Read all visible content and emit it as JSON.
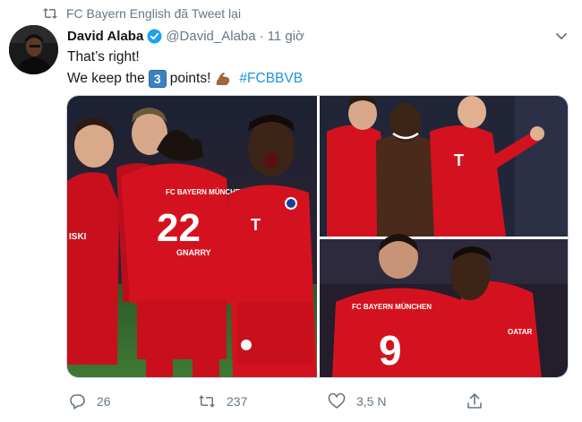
{
  "retweet_banner": {
    "text": "FC Bayern English đã Tweet lại"
  },
  "tweet": {
    "display_name": "David Alaba",
    "handle": "@David_Alaba",
    "separator": "·",
    "timestamp": "11 giờ",
    "line1": "That’s right!",
    "line2_before": "We keep the",
    "keycap": "3",
    "line2_after": "points!",
    "hashtag": "#FCBBVB"
  },
  "media": {
    "jersey_numbers": {
      "left": "22",
      "bottom_right": "9"
    },
    "jersey_names": {
      "left_back": "FC BAYERN MÜNCHEN",
      "left_name": "GNARRY",
      "bottom_back": "FC BAYERN MÜNCHEN"
    },
    "sponsor": "T",
    "sleeve_text": "ISKI",
    "sleeve_text_2": "OATAR"
  },
  "actions": {
    "reply_count": "26",
    "retweet_count": "237",
    "like_count": "3,5 N"
  },
  "colors": {
    "link": "#1b95e0",
    "muted": "#657786",
    "bayern_red": "#d4121f"
  }
}
